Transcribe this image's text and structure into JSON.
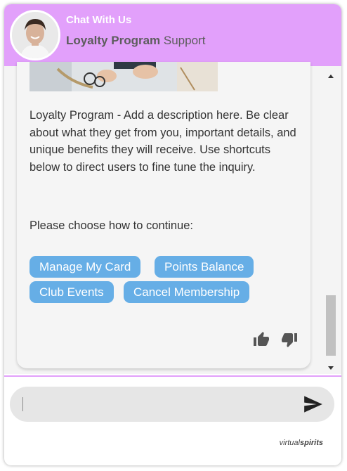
{
  "header": {
    "title": "Chat With Us",
    "subtitle_bold": "Loyalty Program",
    "subtitle_rest": " Support"
  },
  "message": {
    "body": "Loyalty Program - Add a description here. Be clear about what they get from you, important details, and unique benefits they will receive. Use shortcuts below to direct users to fine tune the inquiry.",
    "prompt": "Please choose how to continue:"
  },
  "quick_replies": {
    "manage_card": "Manage My Card",
    "points_balance": "Points Balance",
    "club_events": "Club Events",
    "cancel_membership": "Cancel Membership"
  },
  "input": {
    "value": "",
    "placeholder": ""
  },
  "branding": {
    "light": "virtual",
    "bold": "spirits"
  },
  "colors": {
    "header": "#e2a0fb",
    "chip": "#66aee6",
    "input_bg": "#e6e6e6"
  },
  "icons": {
    "thumbs_up": "thumbs-up-icon",
    "thumbs_down": "thumbs-down-icon",
    "send": "send-icon"
  }
}
